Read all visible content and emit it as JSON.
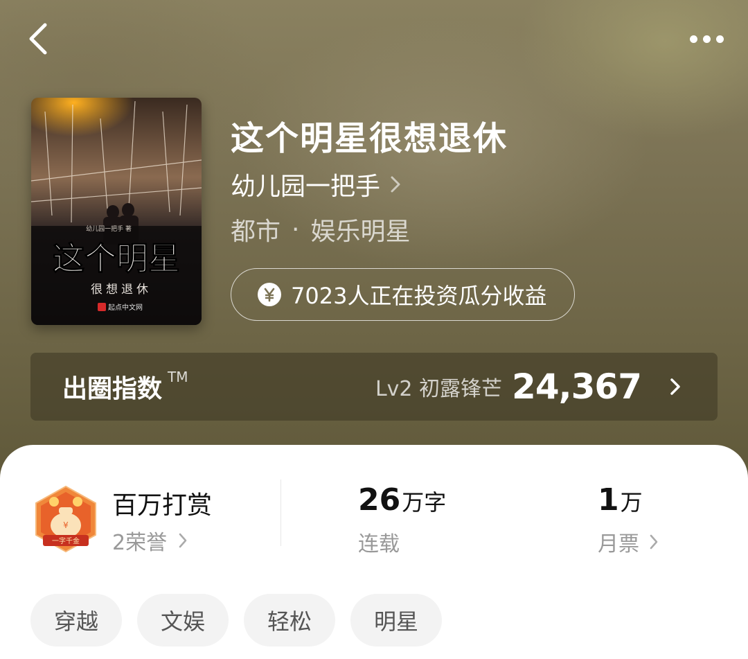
{
  "book": {
    "title": "这个明星很想退休",
    "author": "幼儿园一把手",
    "genre_primary": "都市",
    "genre_separator": "·",
    "genre_secondary": "娱乐明星",
    "invest_text": "7023人正在投资瓜分收益"
  },
  "cover": {
    "title_big": "这个明星",
    "title_small": "很想退休",
    "author_line": "幼儿园一把手 著",
    "publisher": "起点中文网"
  },
  "index": {
    "label": "出圈指数",
    "tm": "TM",
    "level": "Lv2 初露锋芒",
    "value": "24,367"
  },
  "stats": {
    "reward": {
      "title": "百万打赏",
      "sub": "2荣誉",
      "badge_text": "一字千金"
    },
    "words": {
      "number": "26",
      "unit": "万字",
      "label": "连载"
    },
    "tickets": {
      "number": "1",
      "unit": "万",
      "label": "月票"
    }
  },
  "tags": [
    "穿越",
    "文娱",
    "轻松",
    "明星"
  ],
  "icons": {
    "back": "chevron-left-icon",
    "more": "more-horizontal-icon",
    "yen": "yen-coin-icon",
    "arrow": "chevron-right-icon"
  },
  "colors": {
    "hero_bg": "#7b7254",
    "index_bar": "#3c3723",
    "badge_orange": "#e8622a"
  }
}
